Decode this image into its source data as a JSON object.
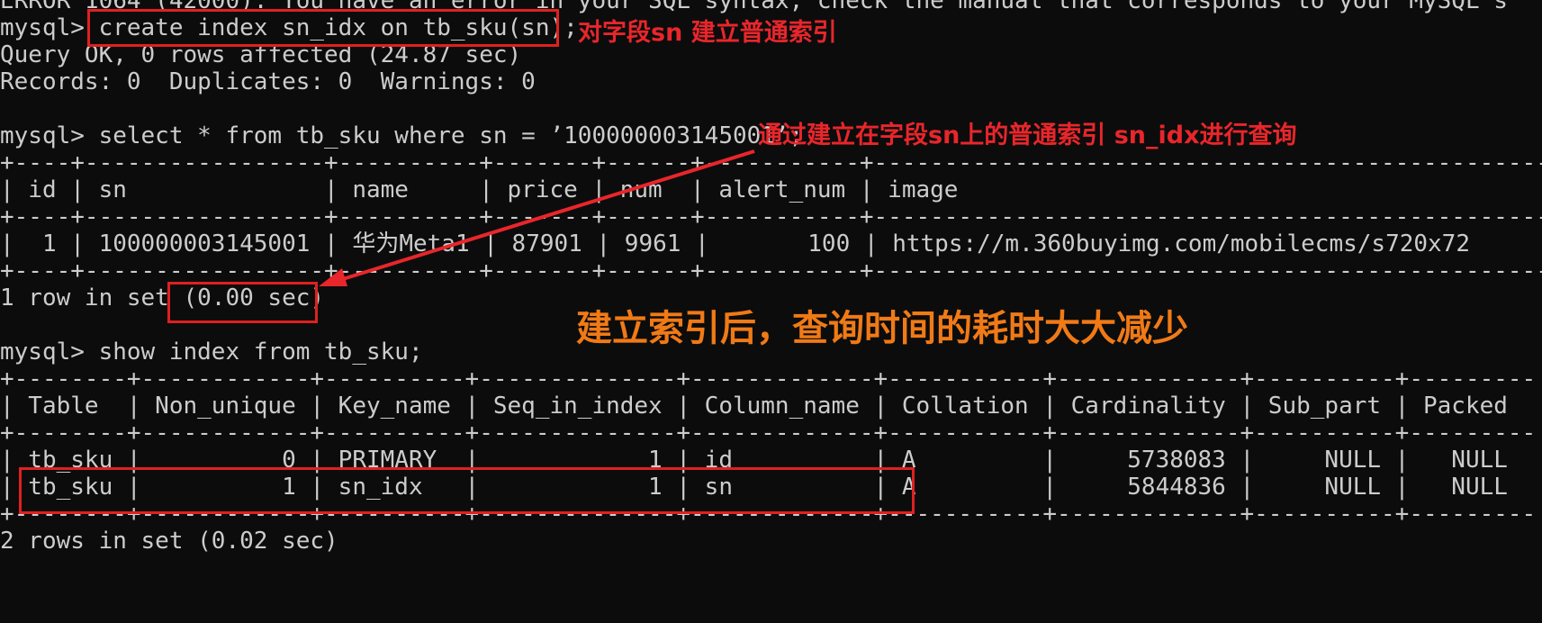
{
  "terminal": {
    "lines": [
      "ERROR 1064 (42000): You have an error in your SQL syntax; check the manual that corresponds to your MySQL s",
      "mysql> create index sn_idx on tb_sku(sn);",
      "Query OK, 0 rows affected (24.87 sec)",
      "Records: 0  Duplicates: 0  Warnings: 0",
      "",
      "mysql> select * from tb_sku where sn = ’100000003145001’;",
      "+----+-----------------+----------+-------+------+-----------+--------------------------------------------------",
      "| id | sn              | name     | price | num  | alert_num | image",
      "+----+-----------------+----------+-------+------+-----------+--------------------------------------------------",
      "|  1 | 100000003145001 | 华为Meta1 | 87901 | 9961 |       100 | https://m.360buyimg.com/mobilecms/s720x72",
      "+----+-----------------+----------+-------+------+-----------+--------------------------------------------------",
      "1 row in set (0.00 sec)",
      "",
      "mysql> show index from tb_sku;",
      "+--------+------------+----------+--------------+-------------+-----------+-------------+----------+---------",
      "| Table  | Non_unique | Key_name | Seq_in_index | Column_name | Collation | Cardinality | Sub_part | Packed",
      "+--------+------------+----------+--------------+-------------+-----------+-------------+----------+---------",
      "| tb_sku |          0 | PRIMARY  |            1 | id          | A         |     5738083 |     NULL |   NULL",
      "| tb_sku |          1 | sn_idx   |            1 | sn          | A         |     5844836 |     NULL |   NULL",
      "+--------+------------+----------+--------------+-------------+-----------+-------------+----------+---------",
      "2 rows in set (0.02 sec)"
    ]
  },
  "annotations": {
    "create_index": "对字段sn 建立普通索引",
    "query_via_index": "通过建立在字段sn上的普通索引 sn_idx进行查询",
    "summary": "建立索引后，查询时间的耗时大大减少"
  },
  "colors": {
    "background": "#0c0c0c",
    "text": "#cccccc",
    "highlight_red": "#e02020",
    "annotation_orange": "#f07a16"
  }
}
